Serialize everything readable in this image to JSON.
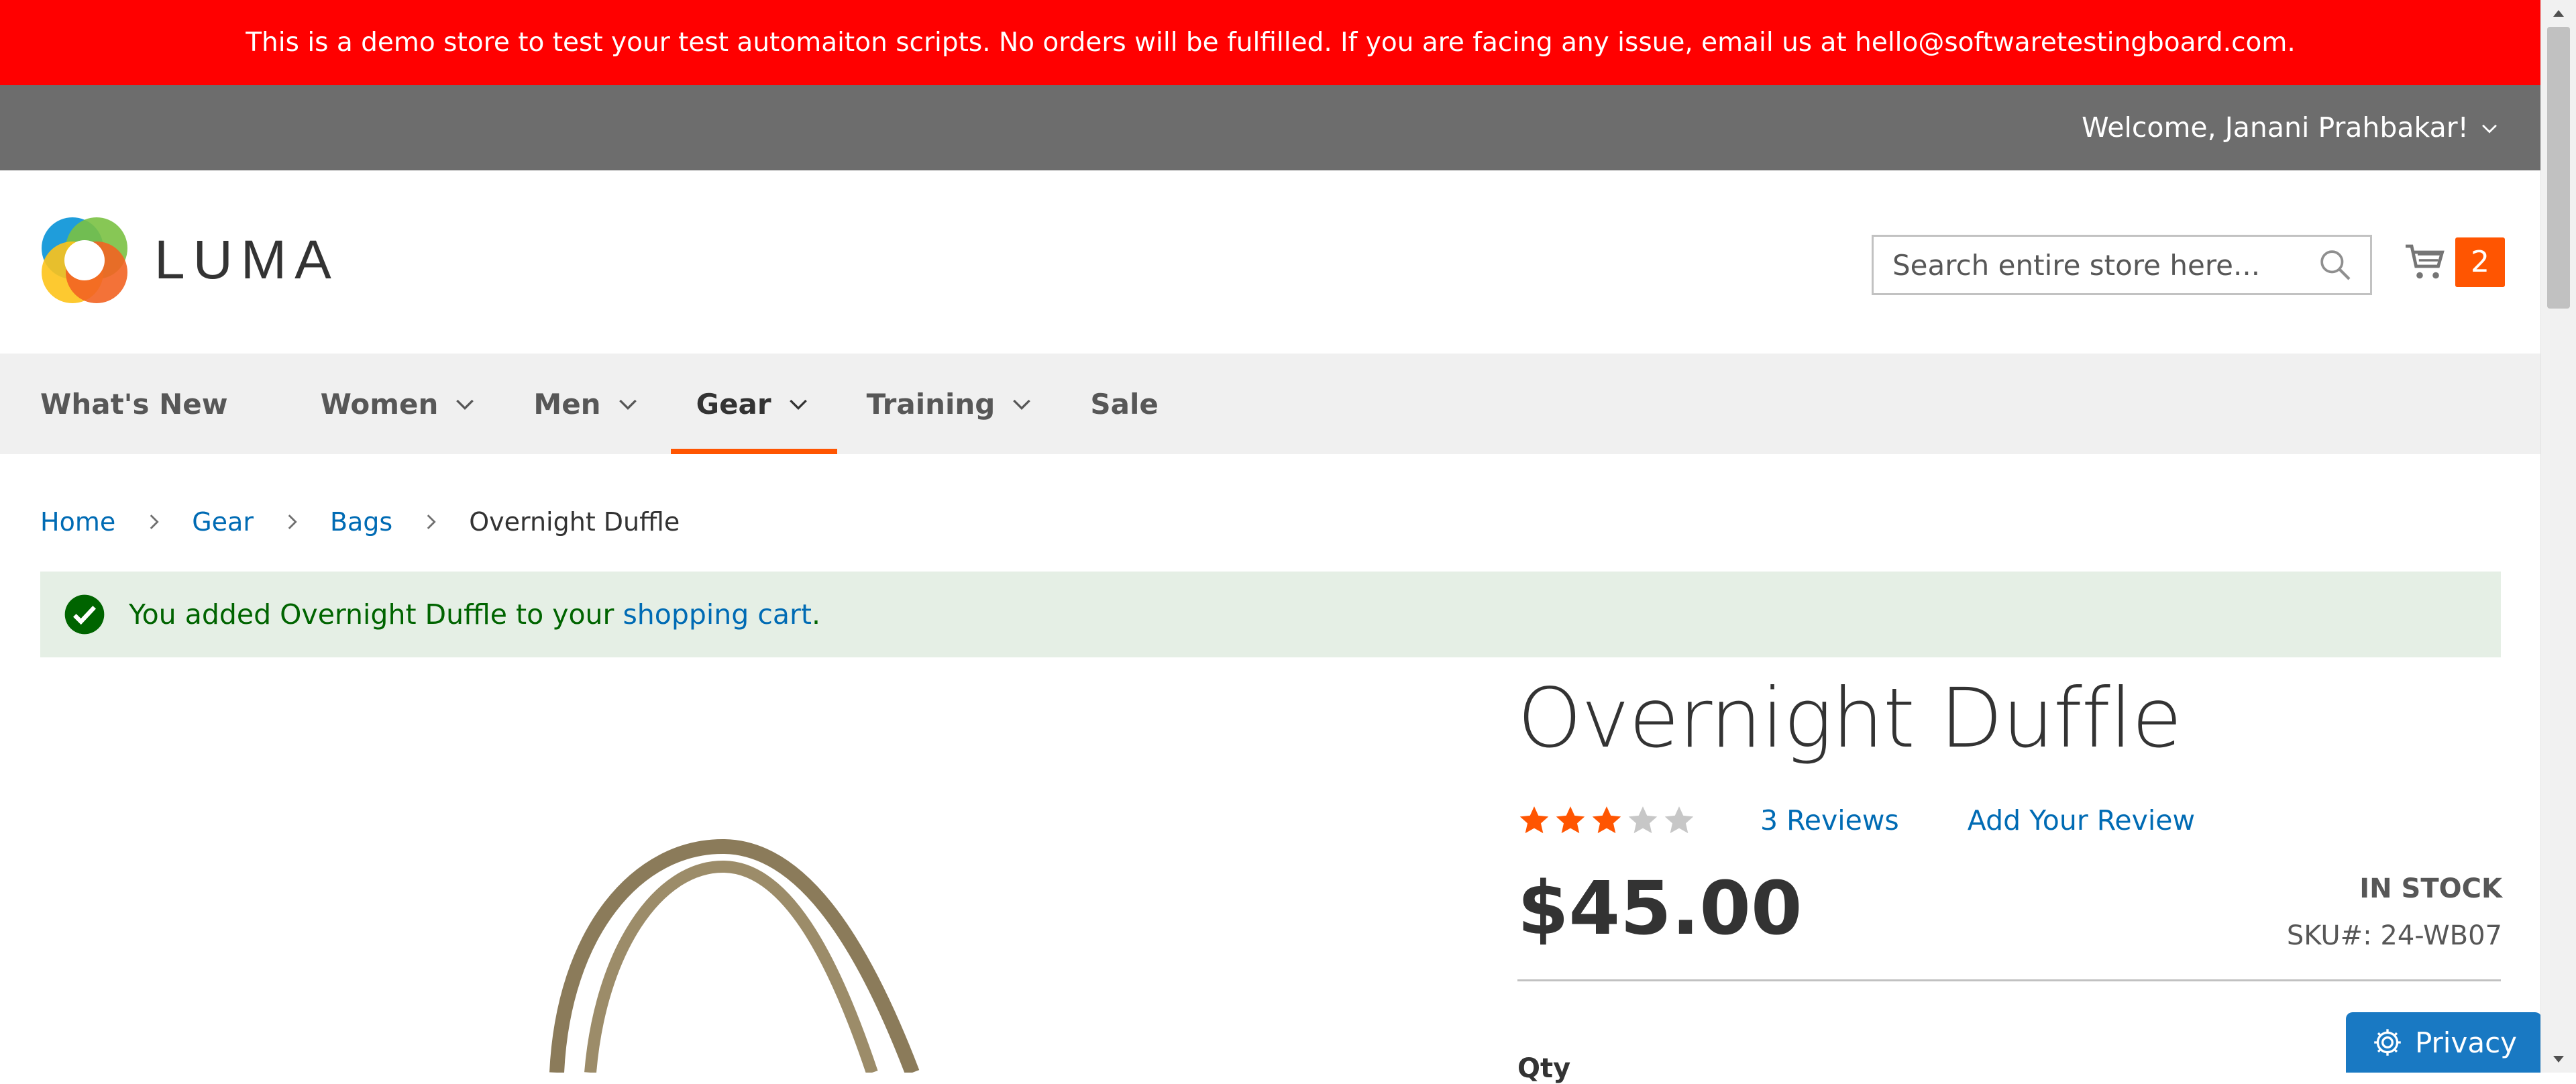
{
  "banner": {
    "text": "This is a demo store to test your test automaiton scripts. No orders will be fulfilled. If you are facing any issue, email us at hello@softwaretestingboard.com."
  },
  "header": {
    "welcome": "Welcome, Janani Prahbakar!",
    "logo_text": "LUMA",
    "search_placeholder": "Search entire store here...",
    "cart_count": "2"
  },
  "nav": {
    "items": [
      {
        "label": "What's New"
      },
      {
        "label": "Women"
      },
      {
        "label": "Men"
      },
      {
        "label": "Gear"
      },
      {
        "label": "Training"
      },
      {
        "label": "Sale"
      }
    ]
  },
  "breadcrumbs": {
    "home": "Home",
    "gear": "Gear",
    "bags": "Bags",
    "current": "Overnight Duffle"
  },
  "message": {
    "prefix": "You added Overnight Duffle to your ",
    "link": "shopping cart",
    "suffix": "."
  },
  "product": {
    "name": "Overnight Duffle",
    "rating": 3,
    "rating_max": 5,
    "reviews_link": "3  Reviews",
    "add_review": "Add Your Review",
    "price": "$45.00",
    "stock": "IN STOCK",
    "sku": "SKU#:  24-WB07",
    "qty_label": "Qty"
  },
  "privacy": {
    "label": "Privacy"
  },
  "colors": {
    "banner": "#ff0000",
    "panel": "#6d6d6d",
    "accent": "#ff5501",
    "link": "#006bb4",
    "success_bg": "#e5efe5",
    "success_text": "#006400",
    "privacy": "#1979c3"
  }
}
